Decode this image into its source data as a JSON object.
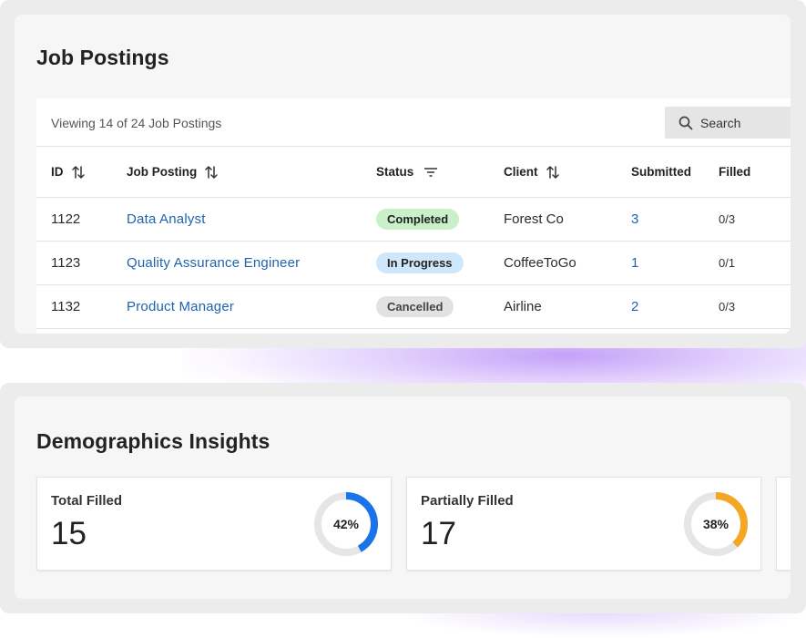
{
  "colors": {
    "accent_blue": "#1d63b0",
    "donut_blue": "#1a73e8",
    "donut_orange": "#f5a623",
    "donut_track": "#e6e6e6",
    "badge_completed": "#c9f0c9",
    "badge_in_progress": "#cfe7fb",
    "badge_cancelled": "#e2e2e2"
  },
  "job_postings": {
    "title": "Job Postings",
    "viewing_text": "Viewing 14 of 24 Job Postings",
    "search_label": "Search",
    "columns": {
      "id": "ID",
      "job_posting": "Job Posting",
      "status": "Status",
      "client": "Client",
      "submitted": "Submitted",
      "filled": "Filled"
    },
    "rows": [
      {
        "id": "1122",
        "job": "Data Analyst",
        "status": "Completed",
        "client": "Forest Co",
        "submitted": "3",
        "filled": "0/3"
      },
      {
        "id": "1123",
        "job": "Quality Assurance Engineer",
        "status": "In Progress",
        "client": "CoffeeToGo",
        "submitted": "1",
        "filled": "0/1"
      },
      {
        "id": "1132",
        "job": "Product Manager",
        "status": "Cancelled",
        "client": "Airline",
        "submitted": "2",
        "filled": "0/3"
      }
    ]
  },
  "demographics": {
    "title": "Demographics Insights",
    "cards": [
      {
        "label": "Total Filled",
        "value": "15",
        "percent_text": "42%",
        "percent": 0.42,
        "color": "#1a73e8"
      },
      {
        "label": "Partially Filled",
        "value": "17",
        "percent_text": "38%",
        "percent": 0.38,
        "color": "#f5a623"
      }
    ]
  }
}
